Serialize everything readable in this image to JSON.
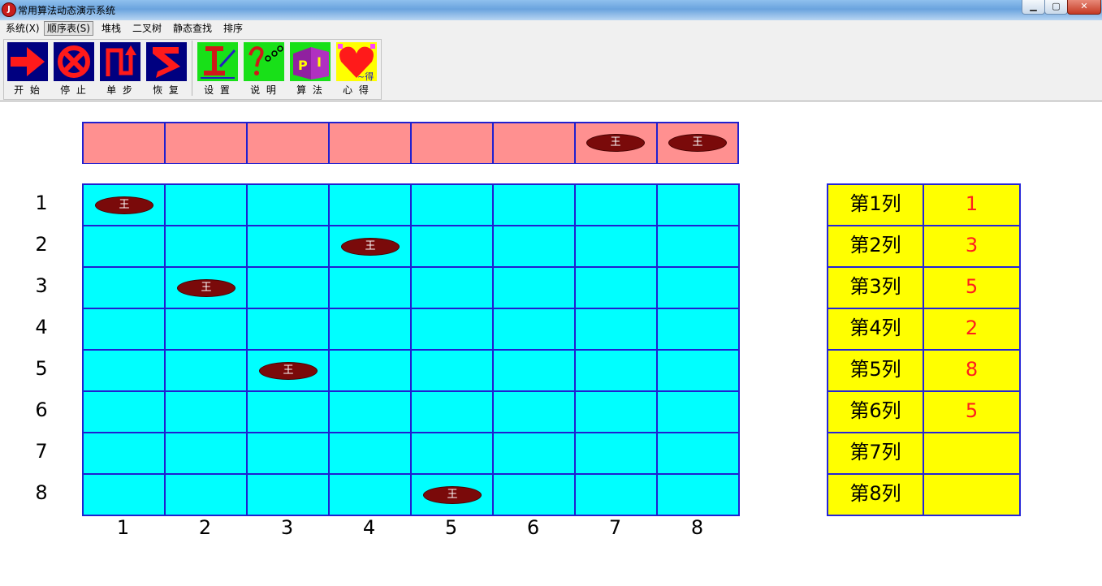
{
  "window": {
    "title": "常用算法动态演示系统",
    "minimize": "▁",
    "maximize": "▢",
    "close": "✕"
  },
  "menu": [
    "系统(X)",
    "顺序表(S)",
    "堆栈",
    "二叉树",
    "静态查找",
    "排序"
  ],
  "toolbar": {
    "buttons": [
      {
        "label": "开 始",
        "icon": "start-arrow-icon"
      },
      {
        "label": "停 止",
        "icon": "stop-icon"
      },
      {
        "label": "单 步",
        "icon": "step-icon"
      },
      {
        "label": "恢 复",
        "icon": "resume-icon"
      },
      {
        "label": "设 置",
        "icon": "settings-icon"
      },
      {
        "label": "说 明",
        "icon": "help-icon"
      },
      {
        "label": "算 法",
        "icon": "algorithm-icon"
      },
      {
        "label": "心 得",
        "icon": "notes-heart-icon"
      }
    ]
  },
  "queen_symbol": "王",
  "board": {
    "size": 8,
    "row_labels": [
      "1",
      "2",
      "3",
      "4",
      "5",
      "6",
      "7",
      "8"
    ],
    "col_labels": [
      "1",
      "2",
      "3",
      "4",
      "5",
      "6",
      "7",
      "8"
    ],
    "queens": [
      {
        "row": 1,
        "col": 1
      },
      {
        "row": 2,
        "col": 4
      },
      {
        "row": 3,
        "col": 2
      },
      {
        "row": 5,
        "col": 3
      },
      {
        "row": 8,
        "col": 5
      }
    ],
    "pending_queens_cols": [
      7,
      8
    ]
  },
  "solution_table": [
    {
      "label": "第1列",
      "value": "1"
    },
    {
      "label": "第2列",
      "value": "3"
    },
    {
      "label": "第3列",
      "value": "5"
    },
    {
      "label": "第4列",
      "value": "2"
    },
    {
      "label": "第5列",
      "value": "8"
    },
    {
      "label": "第6列",
      "value": "5"
    },
    {
      "label": "第7列",
      "value": ""
    },
    {
      "label": "第8列",
      "value": ""
    }
  ],
  "colors": {
    "board_cell": "#00ffff",
    "board_line": "#2020d0",
    "pending_row": "#ff9090",
    "queen": "#7a0a0a",
    "table_bg": "#ffff00",
    "table_value": "#ff1e1e"
  }
}
